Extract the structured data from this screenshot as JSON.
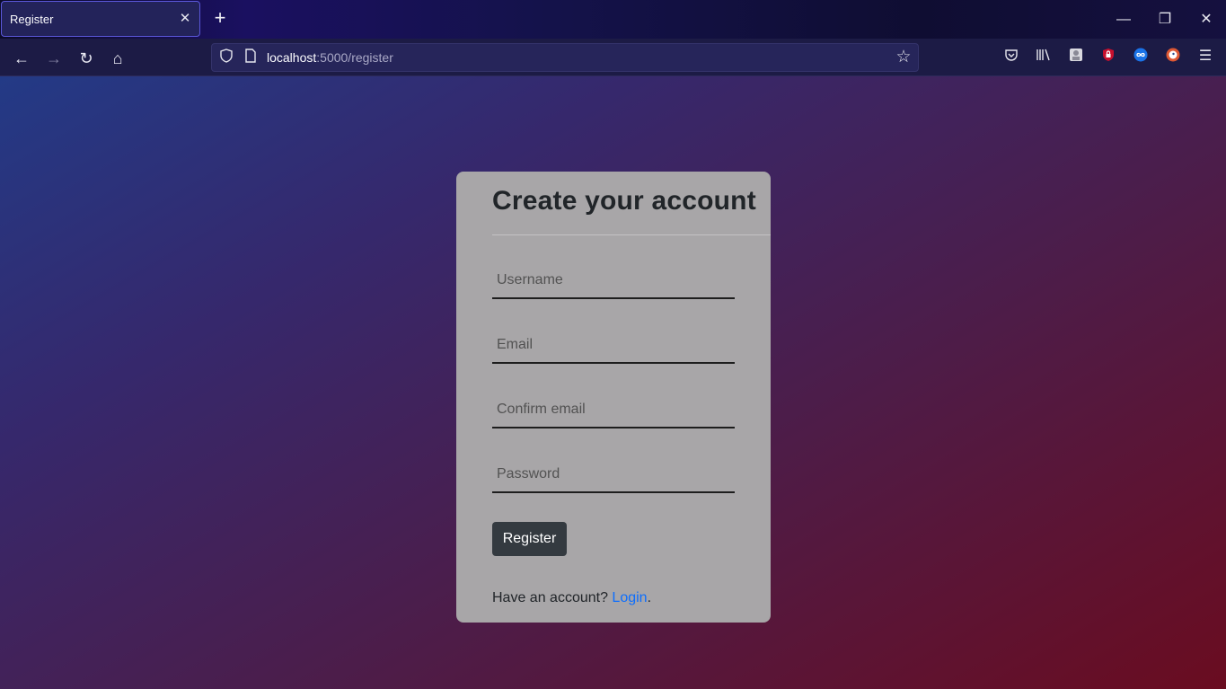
{
  "browser": {
    "tab_title": "Register",
    "tab_close_glyph": "✕",
    "new_tab_glyph": "+",
    "window_controls": {
      "minimize": "—",
      "restore": "❐",
      "close": "✕"
    },
    "nav": {
      "back": "←",
      "forward": "→",
      "reload": "↻",
      "home": "⌂"
    },
    "url": {
      "host": "localhost",
      "rest": ":5000/register"
    },
    "toolbar_icons": [
      "pocket-icon",
      "library-icon",
      "extension-icon",
      "ublock-icon",
      "extension-infinity-icon",
      "duckduckgo-icon",
      "menu-icon"
    ],
    "menu_glyph": "☰",
    "bookmark_glyph": "☆"
  },
  "form": {
    "title": "Create your account",
    "fields": [
      {
        "name": "username",
        "placeholder": "Username"
      },
      {
        "name": "email",
        "placeholder": "Email"
      },
      {
        "name": "confirm_email",
        "placeholder": "Confirm email"
      },
      {
        "name": "password",
        "placeholder": "Password"
      }
    ],
    "submit_label": "Register",
    "footer_prefix": "Have an account? ",
    "footer_link": "Login",
    "footer_suffix": "."
  },
  "colors": {
    "card_bg": "#a8a6a8",
    "button_bg": "#343a40",
    "link": "#0d6efd"
  }
}
